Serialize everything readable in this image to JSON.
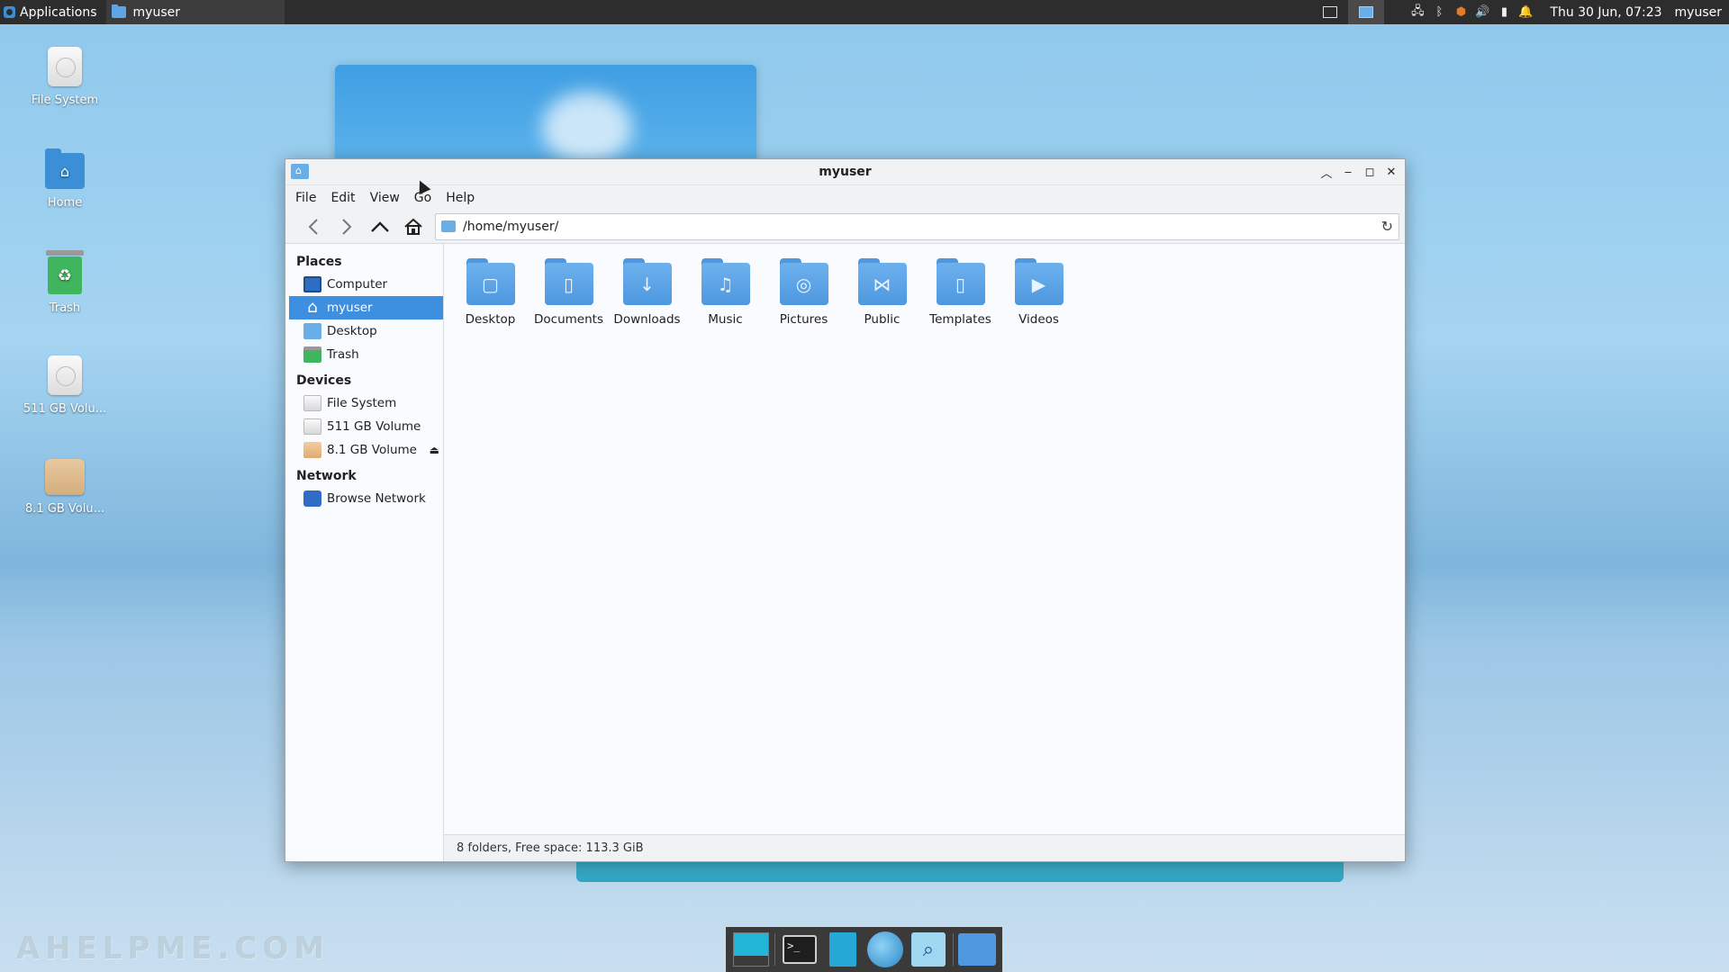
{
  "top_panel": {
    "applications_label": "Applications",
    "task_title": "myuser",
    "clock": "Thu 30 Jun, 07:23",
    "user": "myuser"
  },
  "desktop_icons": [
    {
      "label": "File System"
    },
    {
      "label": "Home"
    },
    {
      "label": "Trash"
    },
    {
      "label": "511 GB Volu..."
    },
    {
      "label": "8.1 GB Volu..."
    }
  ],
  "window": {
    "title": "myuser",
    "menu": [
      "File",
      "Edit",
      "View",
      "Go",
      "Help"
    ],
    "location": "/home/myuser/",
    "sidebar": {
      "places_title": "Places",
      "places": [
        {
          "label": "Computer",
          "icon": "computer-icon"
        },
        {
          "label": "myuser",
          "icon": "home-icon",
          "selected": true
        },
        {
          "label": "Desktop",
          "icon": "desktop-folder-icon"
        },
        {
          "label": "Trash",
          "icon": "trash-icon"
        }
      ],
      "devices_title": "Devices",
      "devices": [
        {
          "label": "File System",
          "icon": "drive-icon"
        },
        {
          "label": "511 GB Volume",
          "icon": "drive-icon"
        },
        {
          "label": "8.1 GB Volume",
          "icon": "removable-drive-icon",
          "eject": true
        }
      ],
      "network_title": "Network",
      "network": [
        {
          "label": "Browse Network",
          "icon": "network-icon"
        }
      ]
    },
    "folders": [
      {
        "label": "Desktop",
        "glyph": "▢"
      },
      {
        "label": "Documents",
        "glyph": "▯"
      },
      {
        "label": "Downloads",
        "glyph": "↓"
      },
      {
        "label": "Music",
        "glyph": "♫"
      },
      {
        "label": "Pictures",
        "glyph": "◎"
      },
      {
        "label": "Public",
        "glyph": "⋈"
      },
      {
        "label": "Templates",
        "glyph": "▯"
      },
      {
        "label": "Videos",
        "glyph": "▶"
      }
    ],
    "status": "8 folders, Free space: 113.3 GiB"
  },
  "watermark": "AHELPME.COM",
  "colors": {
    "accent": "#3d8fe0",
    "folder": "#4f98e0",
    "panel": "#2d2d2d"
  }
}
